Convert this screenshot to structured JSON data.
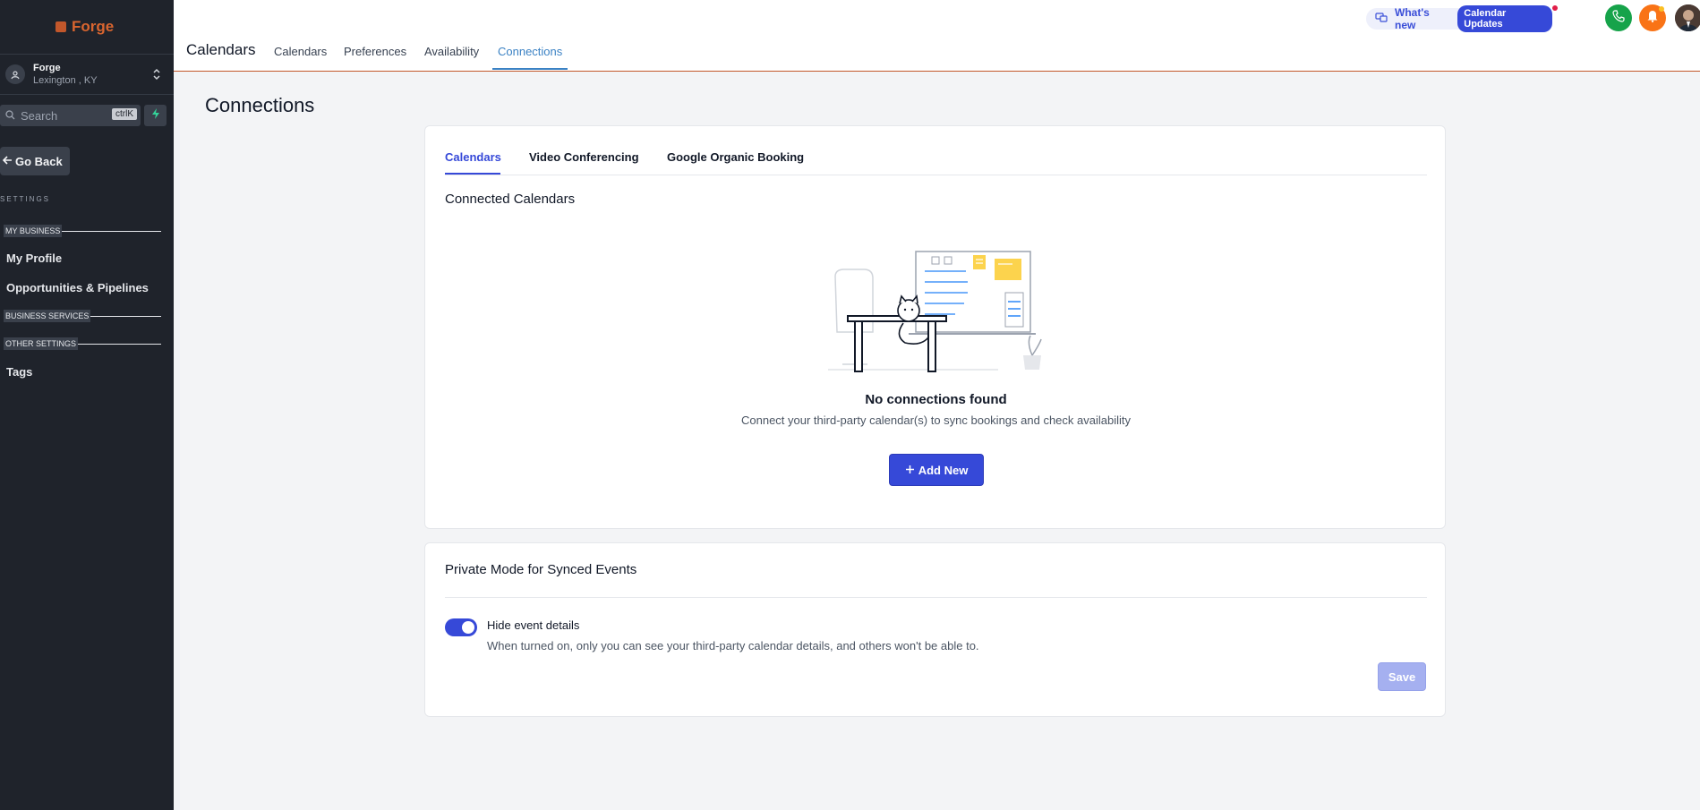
{
  "sidebar": {
    "logo_text": "Forge",
    "location": {
      "name": "Forge",
      "city": "Lexington , KY"
    },
    "search": {
      "label": "Search",
      "shortcut": "ctrlK"
    },
    "go_back": "Go Back",
    "settings_label": "SETTINGS",
    "sections": {
      "my_business": "MY BUSINESS",
      "business_services": "BUSINESS SERVICES",
      "other_settings": "OTHER SETTINGS"
    },
    "items": {
      "my_profile": "My Profile",
      "opportunities": "Opportunities & Pipelines",
      "tags": "Tags"
    }
  },
  "header": {
    "title": "Calendars",
    "tabs": [
      "Calendars",
      "Preferences",
      "Availability",
      "Connections"
    ],
    "active_tab": "Connections",
    "whats_new": "What's new",
    "calendar_updates": "Calendar Updates"
  },
  "main": {
    "title": "Connections",
    "tabs": [
      "Calendars",
      "Video Conferencing",
      "Google Organic Booking"
    ],
    "active_tab": "Calendars",
    "connected_heading": "Connected Calendars",
    "empty_title": "No connections found",
    "empty_subtitle": "Connect your third-party calendar(s) to sync bookings and check availability",
    "add_button": "Add New",
    "private_mode": {
      "heading": "Private Mode for Synced Events",
      "toggle_label": "Hide event details",
      "toggle_on": true,
      "description": "When turned on, only you can see your third-party calendar details, and others won't be able to.",
      "save_button": "Save"
    }
  },
  "colors": {
    "accent": "#3649d8",
    "sidebar_bg": "#1f232b",
    "brand": "#d9652f",
    "tab_active": "#3b82c4"
  }
}
